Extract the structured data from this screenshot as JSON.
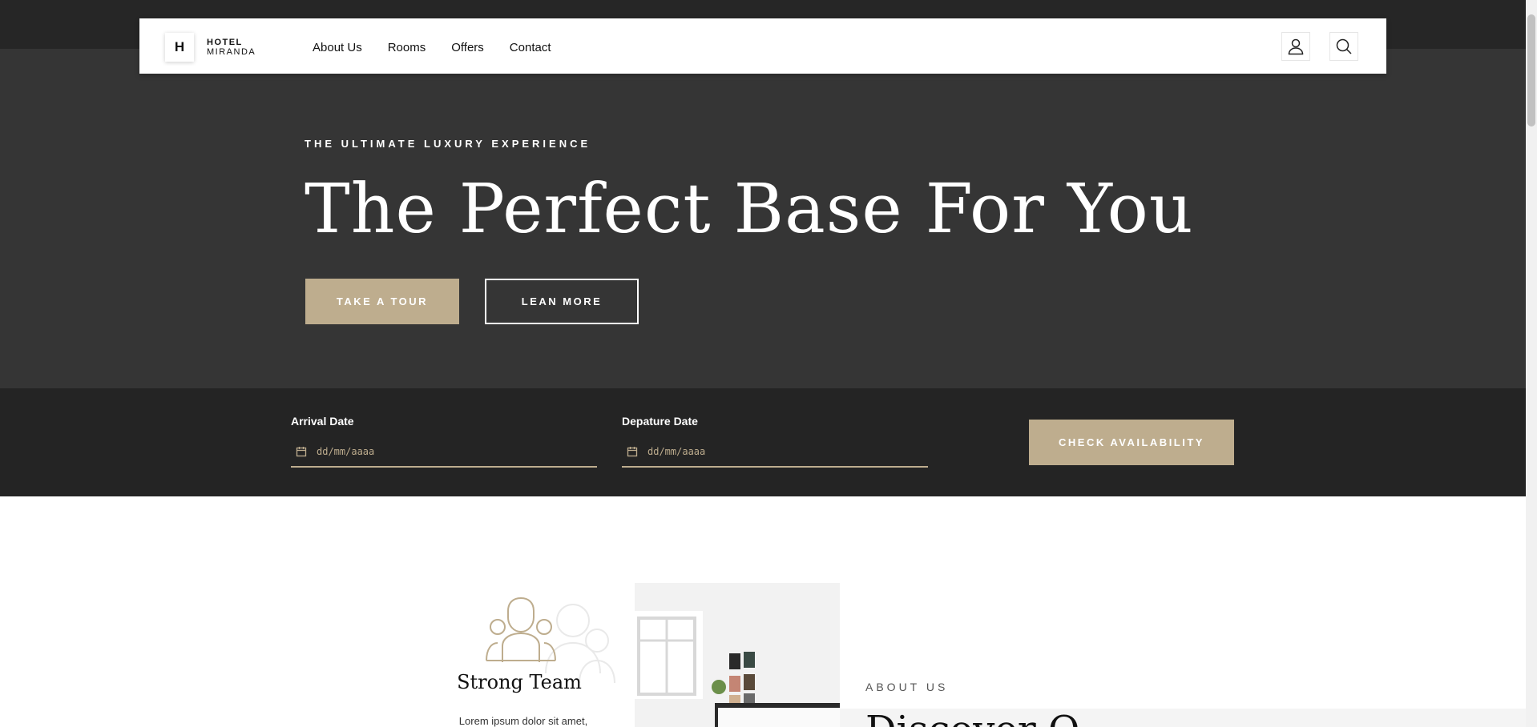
{
  "brand": {
    "initial": "H",
    "line1": "HOTEL",
    "line2": "MIRANDA"
  },
  "nav": {
    "items": [
      "About Us",
      "Rooms",
      "Offers",
      "Contact"
    ]
  },
  "header_icons": {
    "user": "user-icon",
    "search": "search-icon"
  },
  "hero": {
    "eyebrow": "THE ULTIMATE LUXURY EXPERIENCE",
    "headline": "The Perfect Base For You",
    "primary_button": "TAKE A TOUR",
    "secondary_button": "LEAN MORE"
  },
  "booking": {
    "arrival_label": "Arrival Date",
    "arrival_placeholder": "dd/mm/aaaa",
    "departure_label": "Depature Date",
    "departure_placeholder": "dd/mm/aaaa",
    "check_button": "CHECK AVAILABILITY"
  },
  "feature": {
    "icon": "team-icon",
    "title": "Strong Team",
    "text": "Lorem ipsum dolor sit amet,"
  },
  "about": {
    "eyebrow": "ABOUT US",
    "heading": "Discover O"
  },
  "colors": {
    "accent": "#bead8e",
    "hero_bg": "#353535",
    "dark_bg": "#242424"
  }
}
